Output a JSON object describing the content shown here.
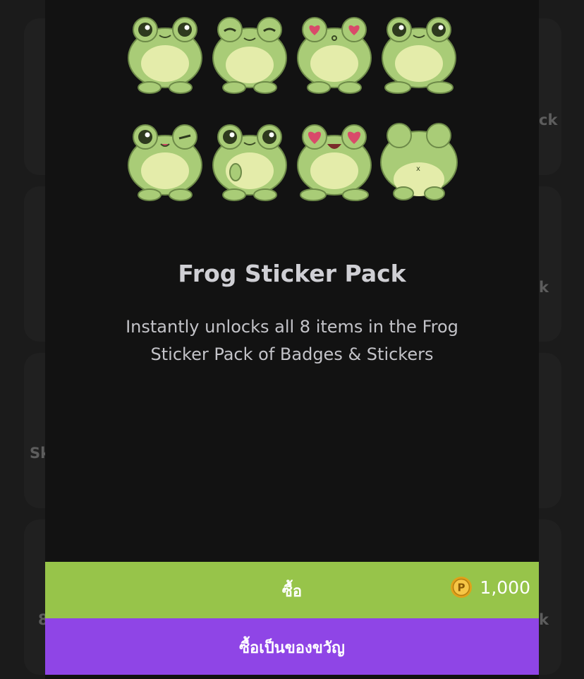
{
  "background": {
    "fragments": [
      "ck",
      "k",
      "Sk",
      "8",
      "k"
    ]
  },
  "modal": {
    "title": "Frog Sticker Pack",
    "description_line1": "Instantly unlocks all 8 items in the Frog",
    "description_line2": "Sticker Pack of Badges & Stickers",
    "stickers": [
      {
        "name": "frog-sticker-1-icon"
      },
      {
        "name": "frog-sticker-2-icon"
      },
      {
        "name": "frog-sticker-3-icon"
      },
      {
        "name": "frog-sticker-4-icon"
      },
      {
        "name": "frog-sticker-5-icon"
      },
      {
        "name": "frog-sticker-6-icon"
      },
      {
        "name": "frog-sticker-7-icon"
      },
      {
        "name": "frog-sticker-8-icon"
      }
    ],
    "buy_label": "ซื้อ",
    "price": "1,000",
    "coin_letter": "P",
    "gift_label": "ซื้อเป็นของขวัญ"
  },
  "colors": {
    "buy": "#97c44a",
    "gift": "#8f45e6",
    "modal_bg": "#121212",
    "frog_body": "#a9cc77",
    "frog_belly": "#e4ecaa"
  }
}
